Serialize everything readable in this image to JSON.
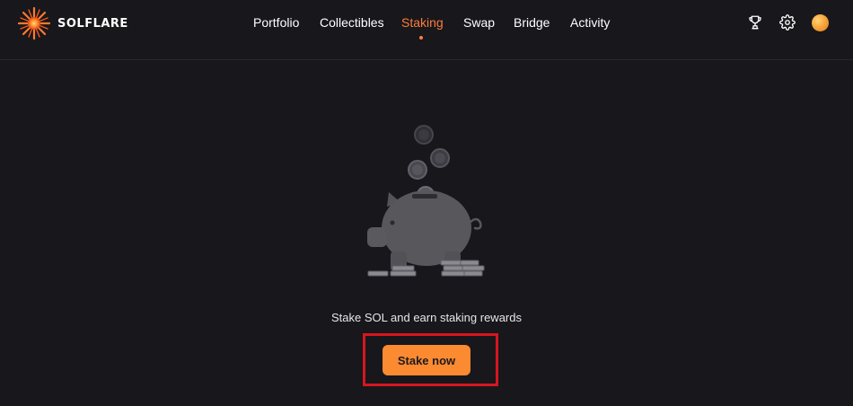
{
  "brand": {
    "name": "SOLFLARE",
    "icon": "solflare-sun-logo"
  },
  "nav": {
    "items": [
      {
        "label": "Portfolio",
        "active": false
      },
      {
        "label": "Collectibles",
        "active": false
      },
      {
        "label": "Staking",
        "active": true
      },
      {
        "label": "Swap",
        "active": false
      },
      {
        "label": "Bridge",
        "active": false
      },
      {
        "label": "Activity",
        "active": false
      }
    ]
  },
  "header_icons": [
    "trophy-icon",
    "settings-gear-icon",
    "account-avatar"
  ],
  "empty_state": {
    "illustration": "piggy-bank-with-coins",
    "message": "Stake SOL and earn staking rewards",
    "cta_label": "Stake now"
  },
  "colors": {
    "background": "#18171c",
    "accent": "#fc7e3a",
    "cta": "#fc8a31",
    "highlight_box": "#d6161f"
  }
}
